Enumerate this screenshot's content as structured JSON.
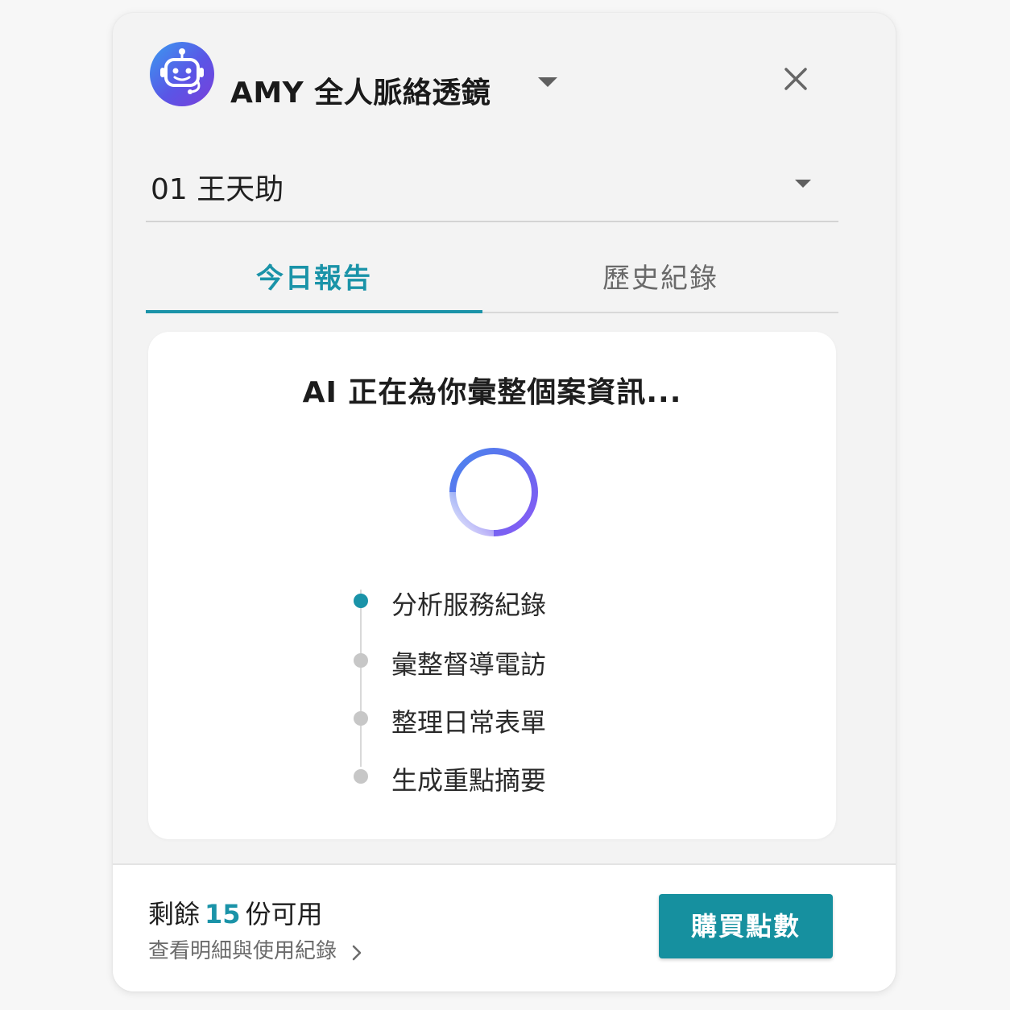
{
  "app": {
    "title": "AMY 全人脈絡透鏡",
    "avatar_icon": "robot-icon"
  },
  "case_selector": {
    "value": "01 王天助"
  },
  "tabs": [
    {
      "label": "今日報告",
      "active": true
    },
    {
      "label": "歷史紀錄",
      "active": false
    }
  ],
  "loading_card": {
    "title": "AI 正在為你彙整個案資訊...",
    "steps": [
      {
        "label": "分析服務紀錄",
        "active": true
      },
      {
        "label": "彙整督導電訪",
        "active": false
      },
      {
        "label": "整理日常表單",
        "active": false
      },
      {
        "label": "生成重點摘要",
        "active": false
      }
    ]
  },
  "footer": {
    "remaining_prefix": "剩餘",
    "remaining_count": "15",
    "remaining_suffix": "份可用",
    "details_link": "查看明細與使用紀錄",
    "buy_button": "購買點數"
  },
  "colors": {
    "accent": "#1a93a8",
    "button": "#16909f",
    "spinner_start": "#4a86ee",
    "spinner_end": "#8b5cf6"
  }
}
